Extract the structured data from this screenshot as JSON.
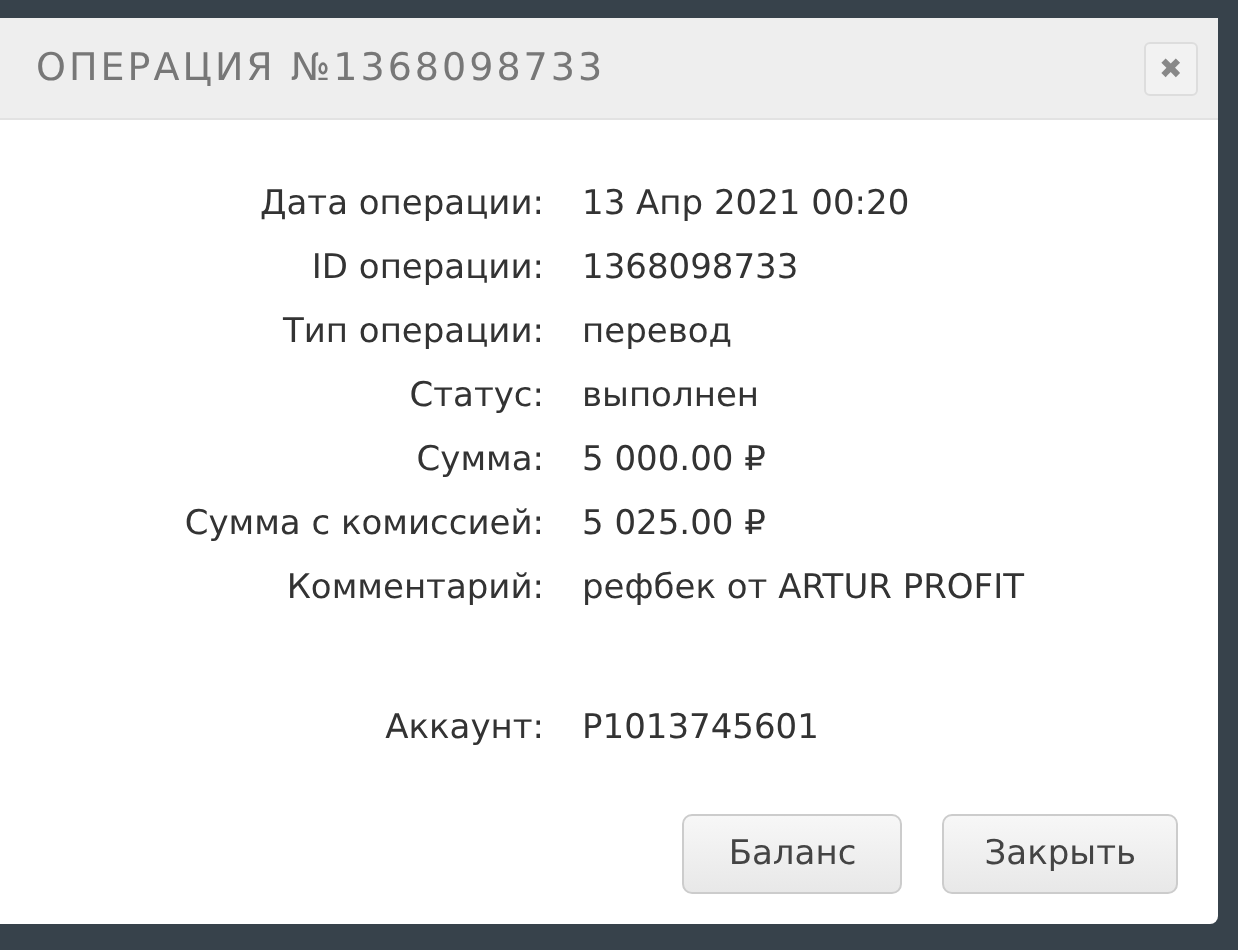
{
  "dialog": {
    "title": "ОПЕРАЦИЯ №1368098733",
    "close": "✖",
    "fields": [
      {
        "label": "Дата операции:",
        "value": "13 Апр 2021 00:20"
      },
      {
        "label": "ID операции:",
        "value": "1368098733"
      },
      {
        "label": "Тип операции:",
        "value": "перевод"
      },
      {
        "label": "Статус:",
        "value": "выполнен"
      },
      {
        "label": "Сумма:",
        "value": "5 000.00 ₽"
      },
      {
        "label": "Сумма с комиссией:",
        "value": "5 025.00 ₽"
      },
      {
        "label": "Комментарий:",
        "value": "рефбек от ARTUR PROFIT"
      }
    ],
    "account": {
      "label": "Аккаунт:",
      "value": "P1013745601"
    },
    "buttons": [
      "Баланс",
      "Закрыть"
    ]
  }
}
